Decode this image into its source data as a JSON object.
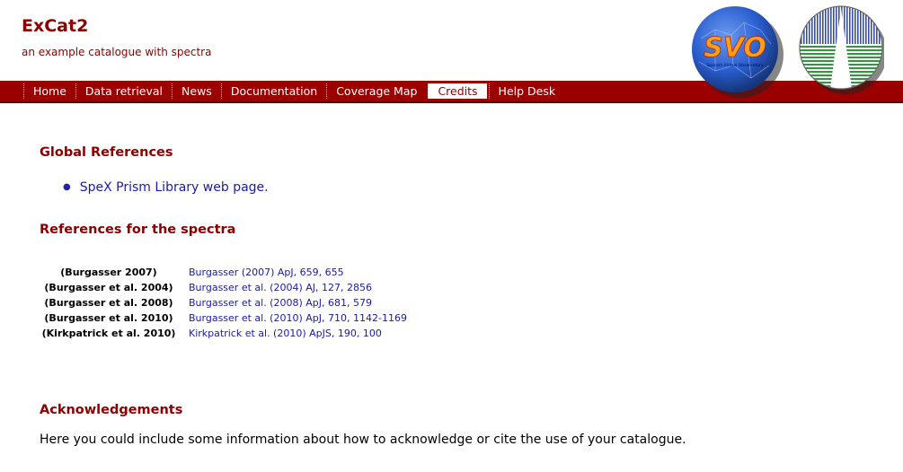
{
  "header": {
    "title": "ExCat2",
    "subtitle": "an example catalogue with spectra",
    "svo_logo_text": "SVO",
    "svo_logo_subtext": "Spanish Virtual Observatory"
  },
  "nav": {
    "items": [
      {
        "label": "Home",
        "active": false
      },
      {
        "label": "Data retrieval",
        "active": false
      },
      {
        "label": "News",
        "active": false
      },
      {
        "label": "Documentation",
        "active": false
      },
      {
        "label": "Coverage Map",
        "active": false
      },
      {
        "label": "Credits",
        "active": true
      },
      {
        "label": "Help Desk",
        "active": false
      }
    ]
  },
  "global_refs": {
    "heading": "Global References",
    "items": [
      {
        "text": "SpeX Prism Library web page."
      }
    ]
  },
  "spectra_refs": {
    "heading": "References for the spectra",
    "rows": [
      {
        "label": "(Burgasser 2007)",
        "citation": "Burgasser (2007) ApJ, 659, 655"
      },
      {
        "label": "(Burgasser et al. 2004)",
        "citation": "Burgasser et al. (2004) AJ, 127, 2856"
      },
      {
        "label": "(Burgasser et al. 2008)",
        "citation": "Burgasser et al. (2008) ApJ, 681, 579"
      },
      {
        "label": "(Burgasser et al. 2010)",
        "citation": "Burgasser et al. (2010) ApJ, 710, 1142-1169"
      },
      {
        "label": "(Kirkpatrick et al. 2010)",
        "citation": "Kirkpatrick et al. (2010) ApJS, 190, 100"
      }
    ]
  },
  "acknowledgements": {
    "heading": "Acknowledgements",
    "text": "Here you could include some information about how to acknowledge or cite the use of your catalogue."
  },
  "colors": {
    "brand": "#8b0000",
    "navbar": "#9b0000",
    "link": "#1a1aaa"
  }
}
